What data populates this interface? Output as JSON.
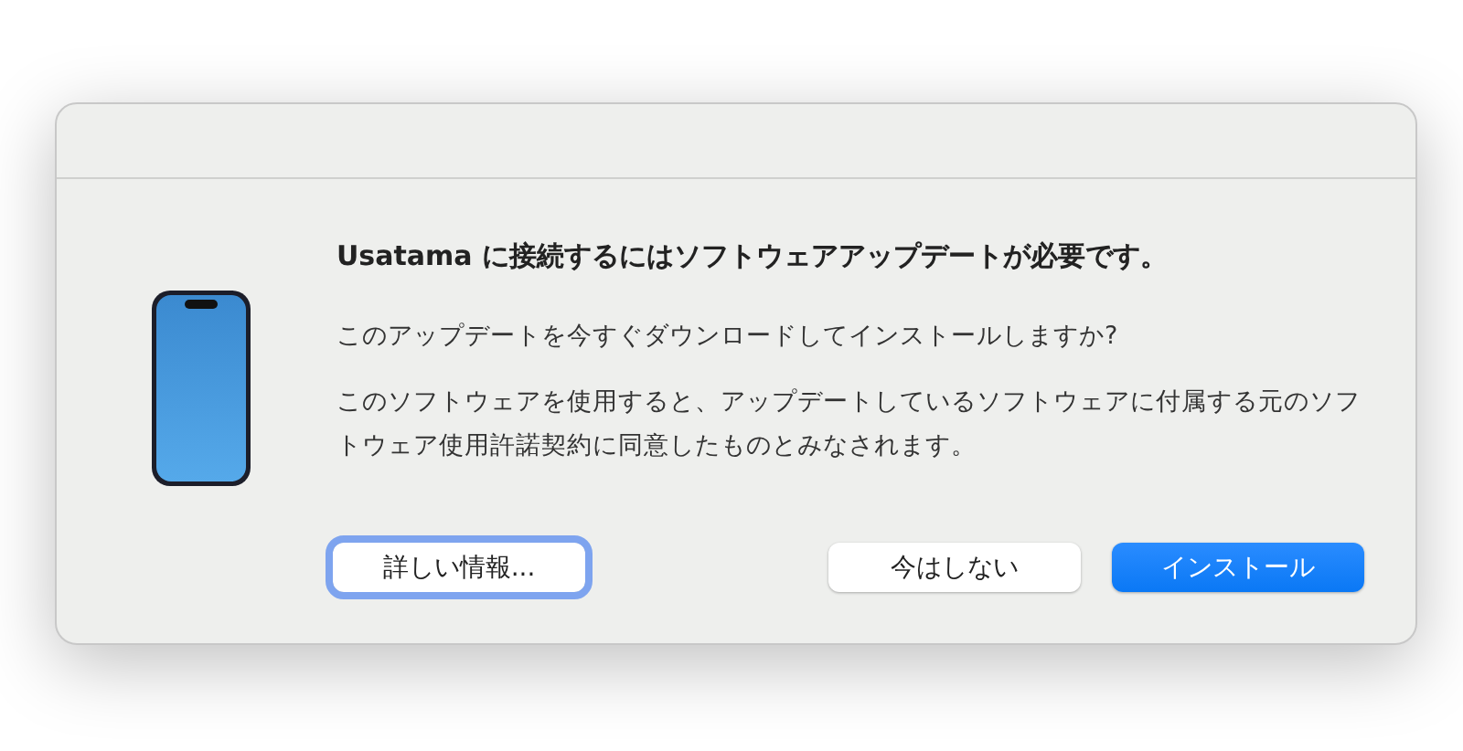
{
  "dialog": {
    "heading": "Usatama に接続するにはソフトウェアアップデートが必要です。",
    "messages": [
      "このアップデートを今すぐダウンロードしてインストールしますか?",
      "このソフトウェアを使用すると、アップデートしているソフトウェアに付属する元のソフトウェア使用許諾契約に同意したものとみなされます。"
    ],
    "buttons": [
      {
        "label": "詳しい情報...",
        "kind": "focused"
      },
      {
        "label": "今はしない",
        "kind": "plain"
      },
      {
        "label": "インストール",
        "kind": "primary"
      }
    ]
  }
}
